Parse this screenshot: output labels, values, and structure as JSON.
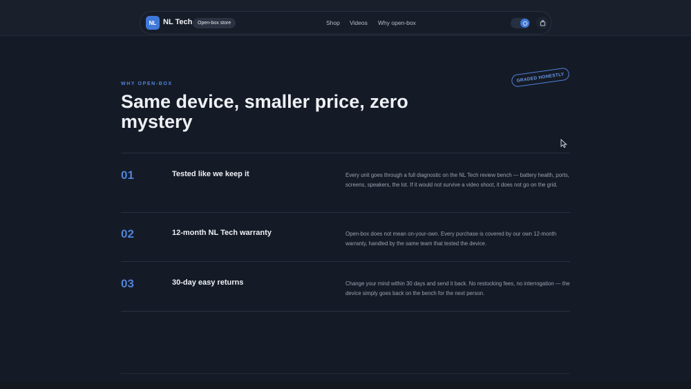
{
  "nav": {
    "logo_text": "NL",
    "brand": "NL Tech",
    "store_label": "Open-box store",
    "links": [
      "Shop",
      "Videos",
      "Why open-box"
    ],
    "accent_color": "#3f78d8"
  },
  "hero": {
    "eyebrow": "WHY OPEN-BOX",
    "title": "Same device, smaller price, zero mystery",
    "stamp": "GRADED HONESTLY"
  },
  "features": [
    {
      "number": "01",
      "title": "Tested like we keep it",
      "description": "Every unit goes through a full diagnostic on the NL Tech review bench — battery health, ports, screens, speakers, the lot. If it would not survive a video shoot, it does not go on the grid."
    },
    {
      "number": "02",
      "title": "12-month NL Tech warranty",
      "description": "Open-box does not mean on-your-own. Every purchase is covered by our own 12-month warranty, handled by the same team that tested the device."
    },
    {
      "number": "03",
      "title": "30-day easy returns",
      "description": "Change your mind within 30 days and send it back. No restocking fees, no interrogation — the device simply goes back on the bench for the next person."
    }
  ]
}
